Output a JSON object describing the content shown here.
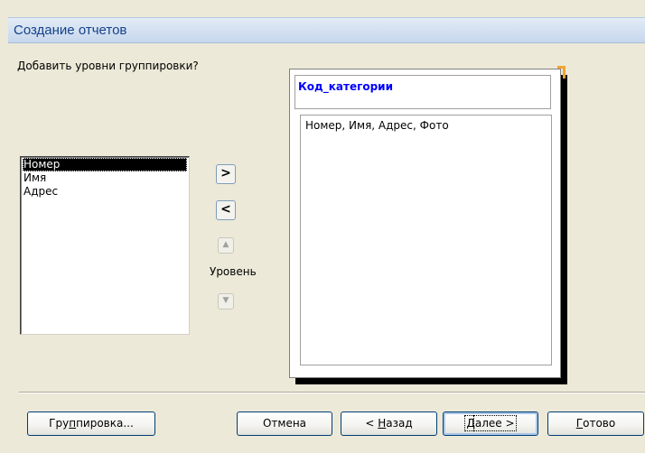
{
  "window": {
    "title": "Создание отчетов"
  },
  "prompt": "Добавить уровни группировки?",
  "fields": [
    "Номер",
    "Имя",
    "Адрес"
  ],
  "selected_field": "Номер",
  "arrow_buttons": {
    "add": ">",
    "remove": "<"
  },
  "level": {
    "label": "Уровень",
    "up_icon": "arrow-up-icon",
    "down_icon": "arrow-down-icon"
  },
  "preview": {
    "group_field": "Код_категории",
    "detail_fields": "Номер, Имя, Адрес, Фото"
  },
  "buttons": {
    "grouping_prefix": "Гру",
    "grouping_underlined": "п",
    "grouping_suffix": "пировка...",
    "cancel": "Отмена",
    "back_prefix": "< ",
    "back_underlined": "Н",
    "back_suffix": "азад",
    "next_underlined": "Д",
    "next_suffix": "алее >",
    "finish_underlined": "Г",
    "finish_suffix": "отово"
  }
}
